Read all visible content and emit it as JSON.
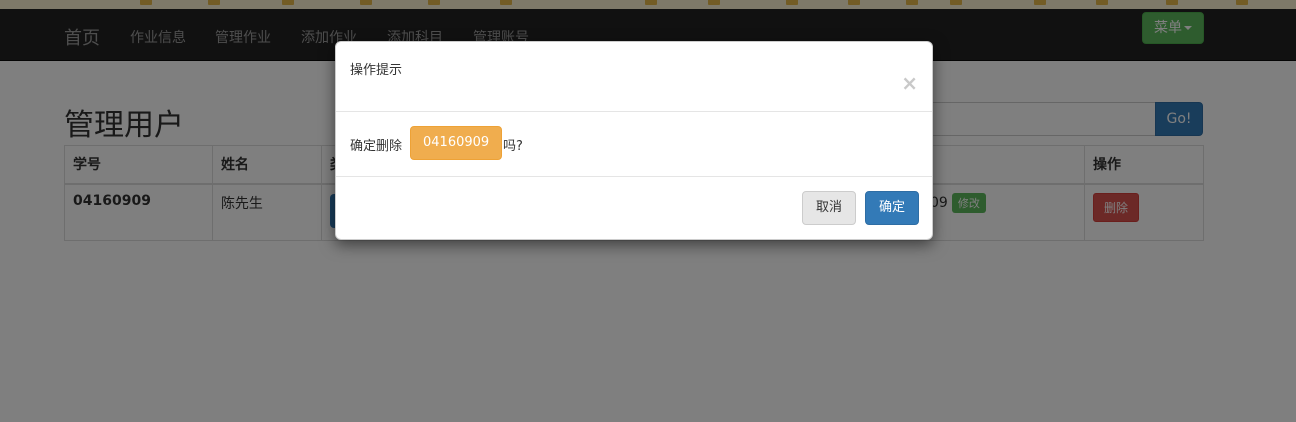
{
  "navbar": {
    "brand": "首页",
    "items": [
      {
        "label": "作业信息"
      },
      {
        "label": "管理作业"
      },
      {
        "label": "添加作业"
      },
      {
        "label": "添加科目"
      },
      {
        "label": "管理账号"
      }
    ],
    "menu_label": "菜单"
  },
  "page": {
    "title": "管理用户",
    "search_button": "Go!"
  },
  "table": {
    "headers": [
      "学号",
      "姓名",
      "类",
      "",
      "",
      "操作"
    ],
    "rows": [
      {
        "student_id": "04160909",
        "name": "陈先生",
        "suffix": "09",
        "edit_label": "修改",
        "delete_label": "删除"
      }
    ]
  },
  "modal": {
    "title": "操作提示",
    "close": "×",
    "message_prefix": "确定删除",
    "target_id": "04160909",
    "message_suffix": "吗?",
    "cancel_label": "取消",
    "confirm_label": "确定"
  }
}
